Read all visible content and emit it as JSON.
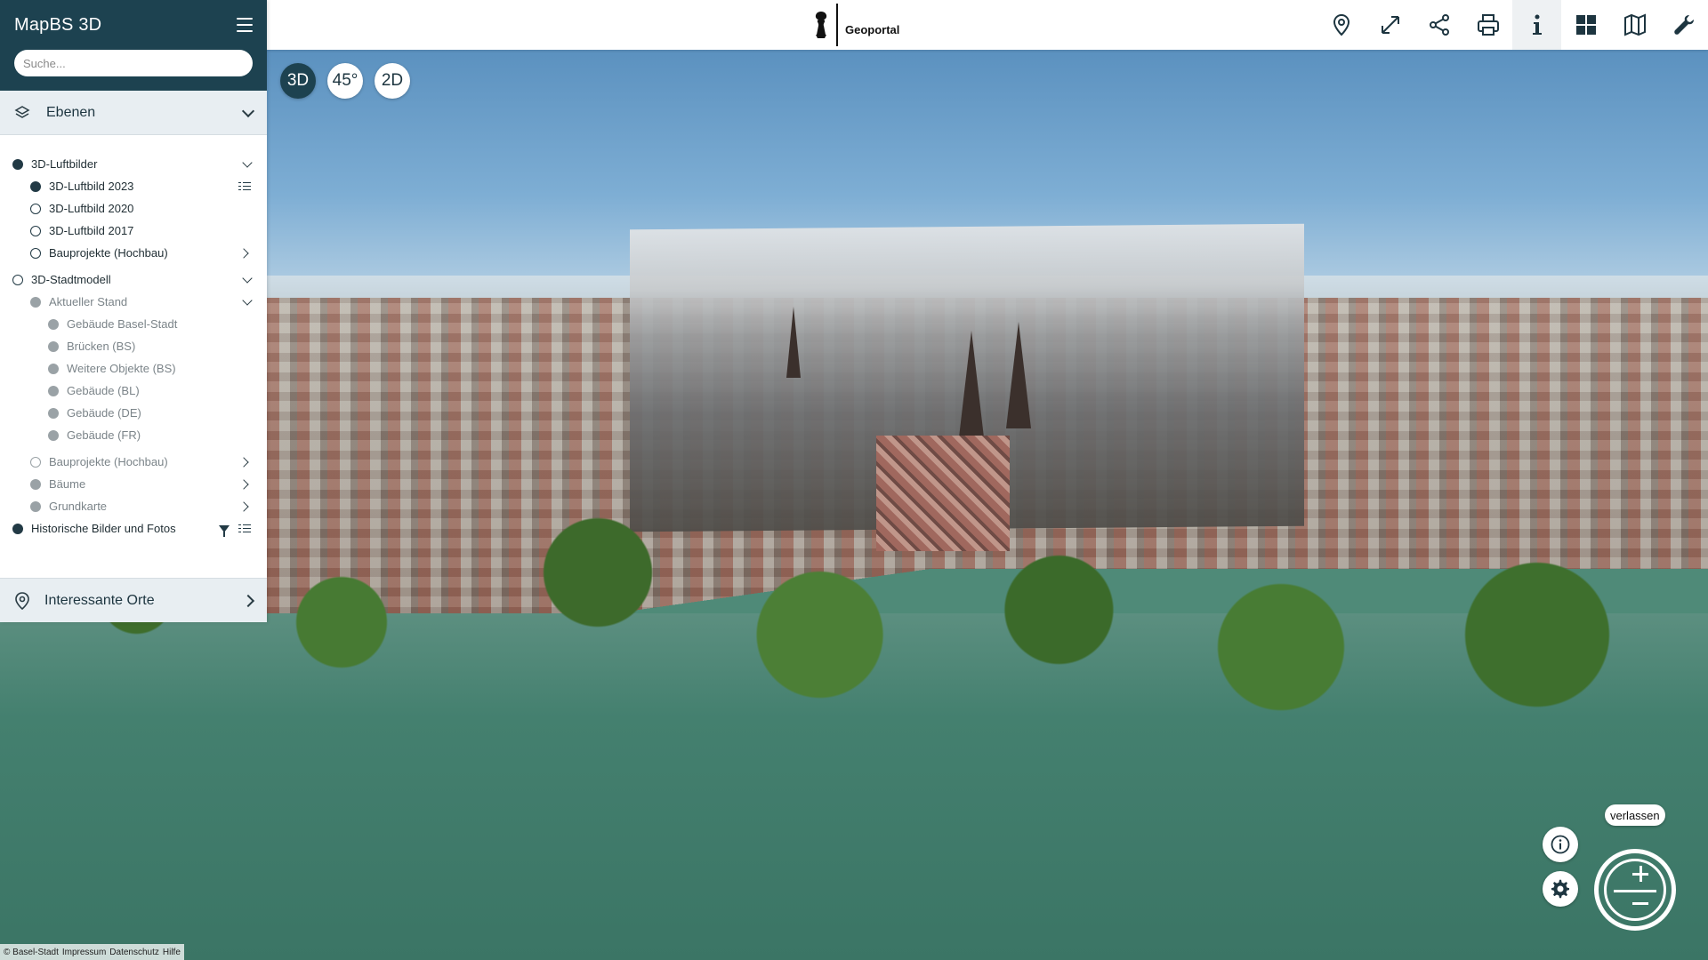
{
  "app": {
    "title": "MapBS 3D"
  },
  "search": {
    "placeholder": "Suche..."
  },
  "brand": {
    "text": "Geoportal"
  },
  "toolbar": {
    "items": [
      {
        "icon": "location-pin-icon"
      },
      {
        "icon": "fullscreen-icon"
      },
      {
        "icon": "share-icon"
      },
      {
        "icon": "print-icon"
      },
      {
        "icon": "info-icon",
        "active": true
      },
      {
        "icon": "grid-icon"
      },
      {
        "icon": "map-icon"
      },
      {
        "icon": "wrench-icon"
      }
    ]
  },
  "view_modes": {
    "mode_3d": "3D",
    "mode_45": "45°",
    "mode_2d": "2D",
    "selected": "3D"
  },
  "layers_panel": {
    "title": "Ebenen",
    "groups": {
      "luftbilder": {
        "label": "3D-Luftbilder",
        "items": [
          "3D-Luftbild 2023",
          "3D-Luftbild 2020",
          "3D-Luftbild 2017",
          "Bauprojekte (Hochbau)"
        ]
      },
      "stadtmodell": {
        "label": "3D-Stadtmodell",
        "aktueller_stand": {
          "label": "Aktueller Stand",
          "items": [
            "Gebäude Basel-Stadt",
            "Brücken (BS)",
            "Weitere Objekte (BS)",
            "Gebäude (BL)",
            "Gebäude (DE)",
            "Gebäude (FR)"
          ]
        },
        "other_items": [
          "Bauprojekte (Hochbau)",
          "Bäume",
          "Grundkarte"
        ]
      },
      "historisch": {
        "label": "Historische Bilder und Fotos"
      }
    }
  },
  "poi_panel": {
    "title": "Interessante Orte"
  },
  "controls": {
    "leave_label": "verlassen"
  },
  "footer": {
    "copyright": "© Basel-Stadt",
    "impressum": "Impressum",
    "datenschutz": "Datenschutz",
    "hilfe": "Hilfe"
  },
  "colors": {
    "sidebar_header": "#1d4250",
    "accent": "#223a45",
    "panel_bg": "#e8eef2"
  }
}
